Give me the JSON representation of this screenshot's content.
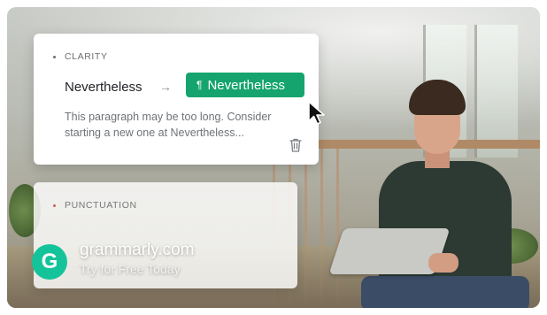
{
  "cards": {
    "clarity": {
      "category": "CLARITY",
      "original_word": "Nevertheless",
      "suggestion": "Nevertheless",
      "suggestion_icon": "¶",
      "description": "This paragraph may be too long. Consider starting a new one at Nevertheless..."
    },
    "punctuation": {
      "category": "PUNCTUATION"
    }
  },
  "brand": {
    "logo_letter": "G",
    "name": "grammarly.com",
    "tagline": "Try for Free Today"
  },
  "colors": {
    "accent": "#15a46e",
    "brand_badge": "#15c39a",
    "punctuation_dot": "#d4504a"
  },
  "icons": [
    "arrow-right-icon",
    "pilcrow-icon",
    "trash-icon",
    "mouse-cursor-icon",
    "grammarly-logo-icon"
  ]
}
